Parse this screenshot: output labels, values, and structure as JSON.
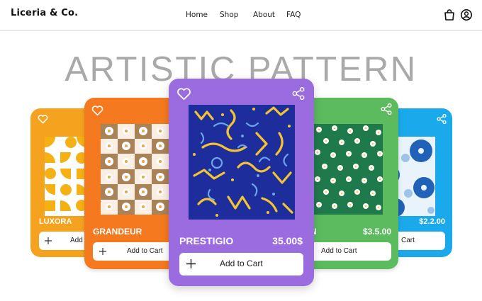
{
  "brand": "Liceria & Co.",
  "nav": [
    "Home",
    "Shop",
    "About",
    "FAQ"
  ],
  "hero_title": "ARTISTIC PATTERN",
  "icons": {
    "bag": "shopping-bag-icon",
    "account": "user-account-icon",
    "favorite": "heart-icon",
    "share": "share-icon",
    "add": "plus-icon"
  },
  "cards": {
    "luxora": {
      "name": "LUXORA",
      "cta": "Add to Cart",
      "color": "#f5a21f"
    },
    "grandeur": {
      "name": "GRANDEUR",
      "cta": "Add to Cart",
      "color": "#f57a1f"
    },
    "prestigio": {
      "name": "PRESTIGIO",
      "price": "35.00$",
      "cta": "Add to Cart",
      "color": "#9b6be0"
    },
    "green": {
      "name_partial": "N",
      "price": "$3.5.00",
      "cta": "Add to Cart",
      "color": "#5bbb5e"
    },
    "blue": {
      "price": "$2.2.00",
      "cta": "Cart",
      "color": "#1aa9ea"
    }
  }
}
